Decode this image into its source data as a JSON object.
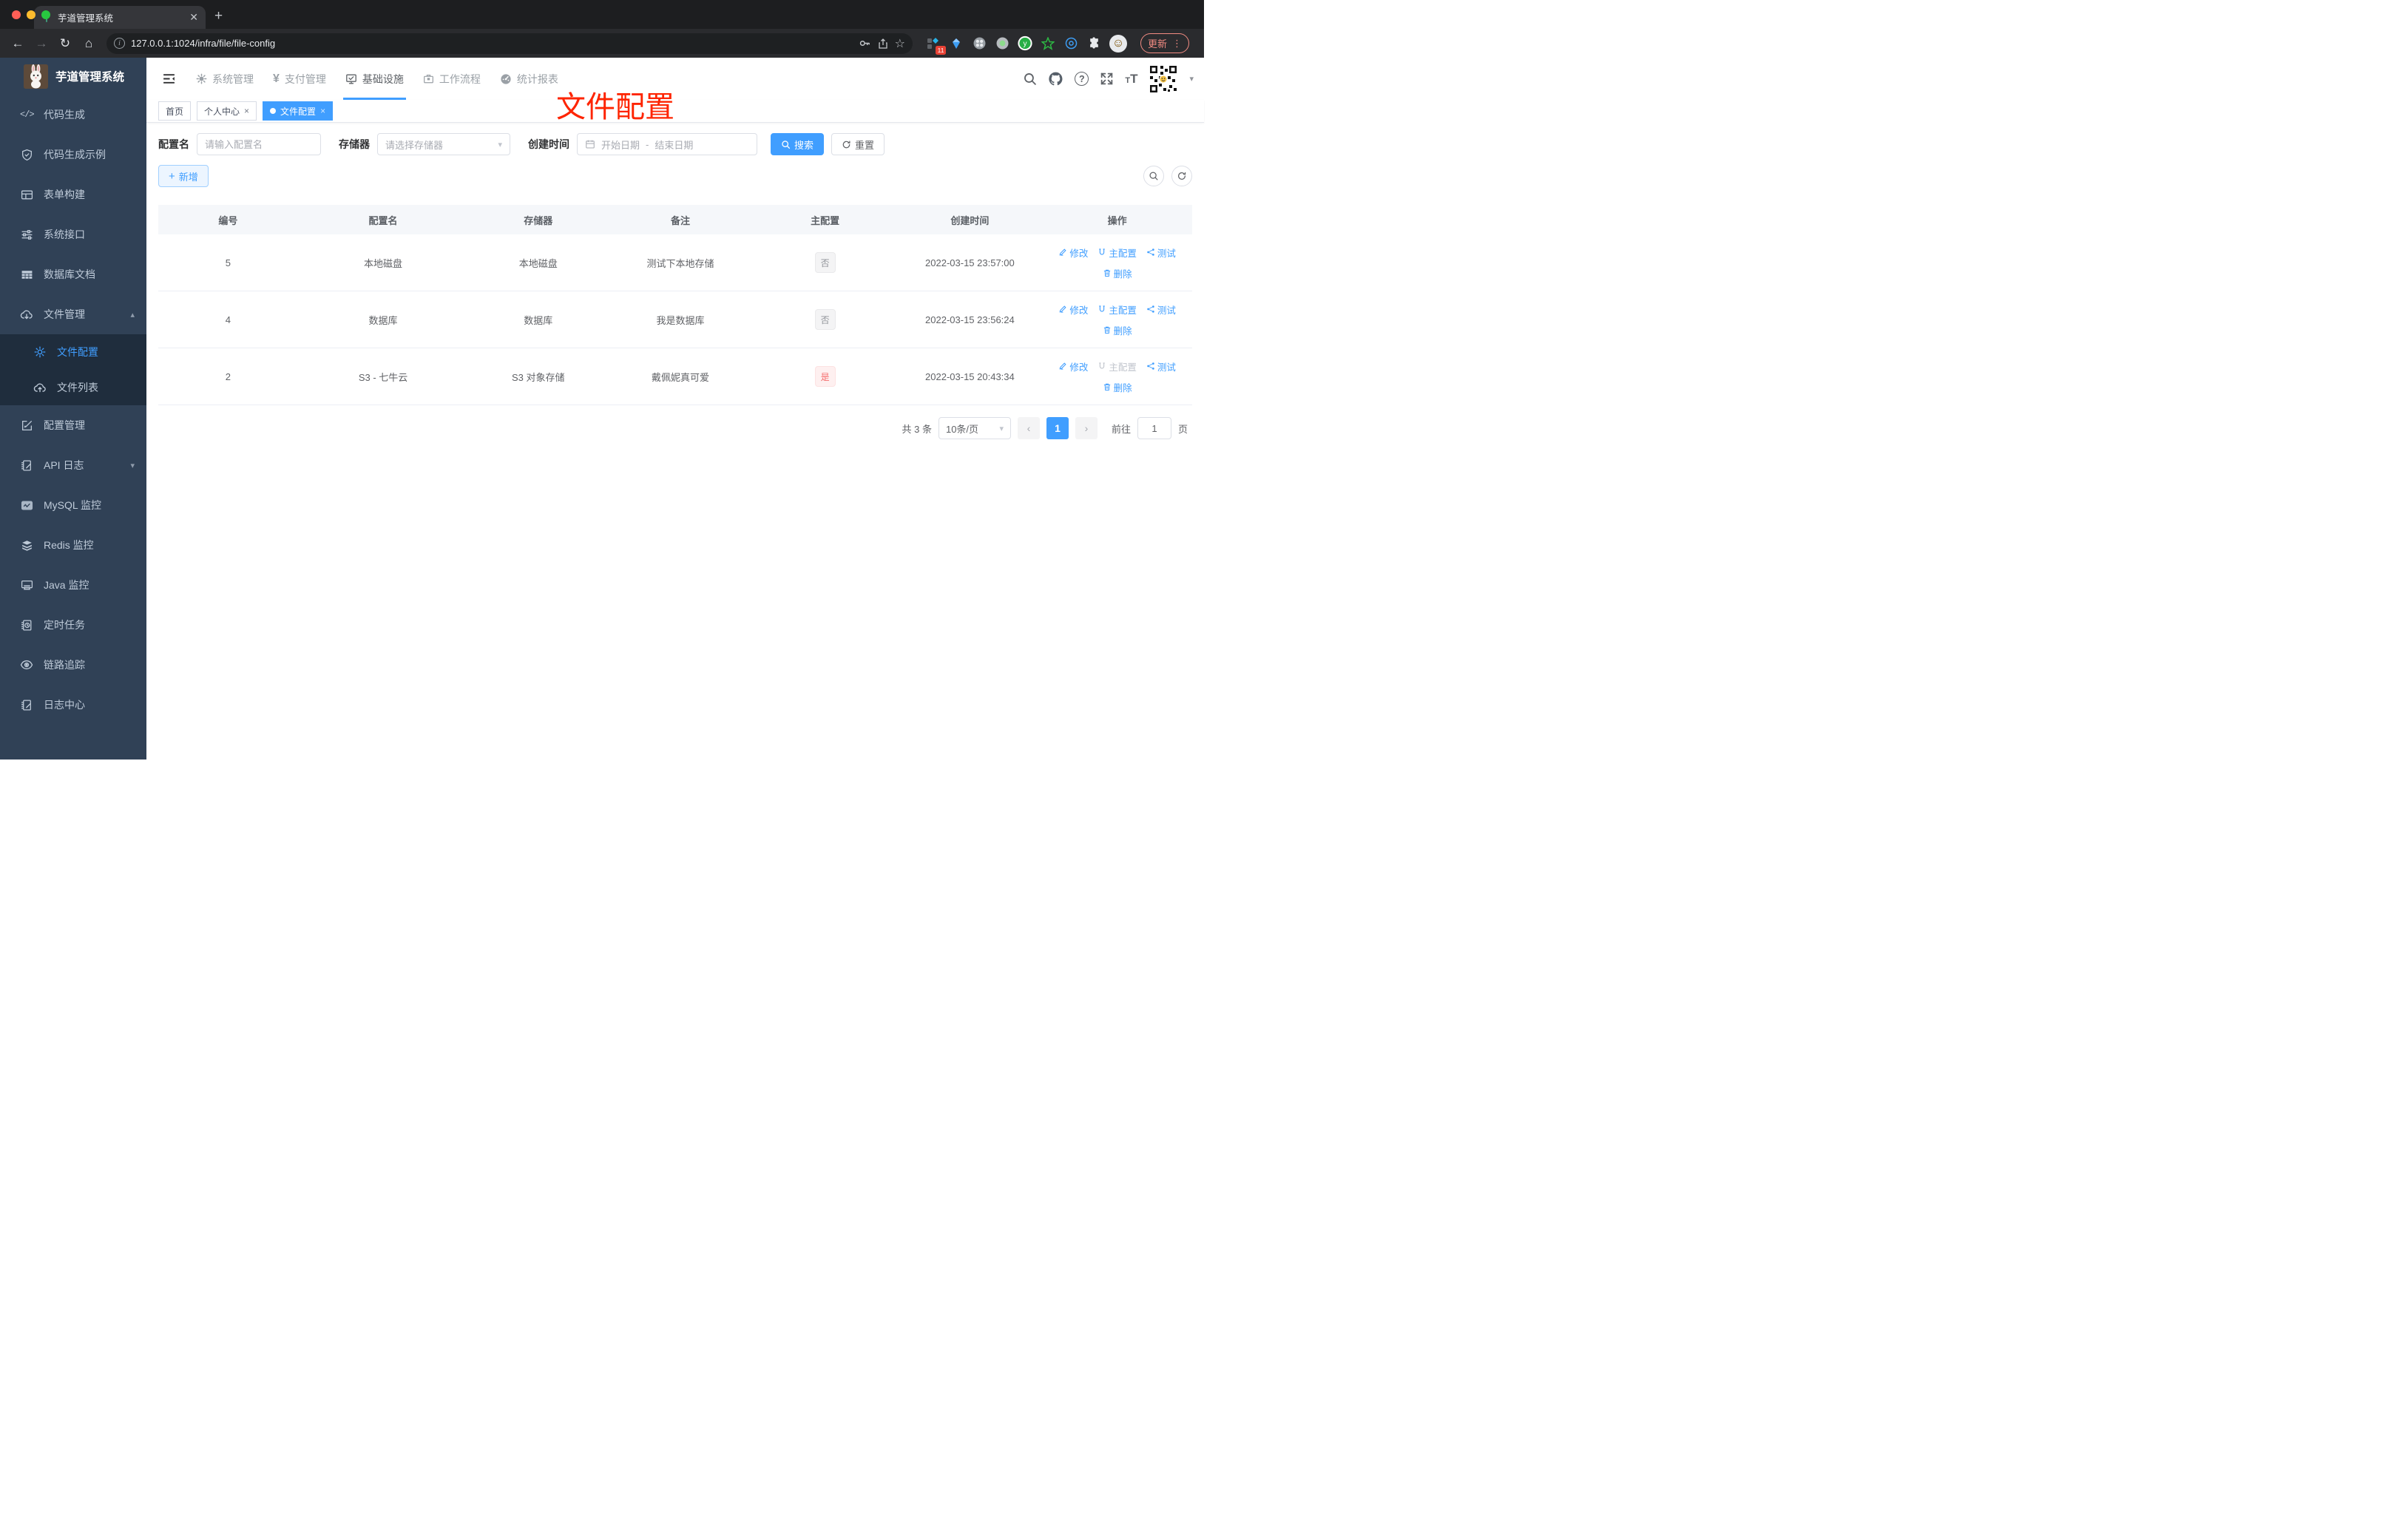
{
  "browser": {
    "tab_title": "芋道管理系统",
    "url": "127.0.0.1:1024/infra/file/file-config",
    "update_label": "更新",
    "extension_badge": "11"
  },
  "sidebar": {
    "logo_title": "芋道管理系统",
    "items": [
      {
        "icon": "code-icon",
        "label": "代码生成"
      },
      {
        "icon": "shield-check-icon",
        "label": "代码生成示例"
      },
      {
        "icon": "form-grid-icon",
        "label": "表单构建"
      },
      {
        "icon": "sliders-icon",
        "label": "系统接口"
      },
      {
        "icon": "table-icon",
        "label": "数据库文档"
      },
      {
        "icon": "cloud-download-icon",
        "label": "文件管理"
      },
      {
        "icon": "gear-icon",
        "label": "文件配置"
      },
      {
        "icon": "cloud-upload-icon",
        "label": "文件列表"
      },
      {
        "icon": "edit-square-icon",
        "label": "配置管理"
      },
      {
        "icon": "note-edit-icon",
        "label": "API 日志"
      },
      {
        "icon": "chart-monitor-icon",
        "label": "MySQL 监控"
      },
      {
        "icon": "layers-icon",
        "label": "Redis 监控"
      },
      {
        "icon": "monitor-icon",
        "label": "Java 监控"
      },
      {
        "icon": "schedule-icon",
        "label": "定时任务"
      },
      {
        "icon": "eye-icon",
        "label": "链路追踪"
      },
      {
        "icon": "log-edit-icon",
        "label": "日志中心"
      }
    ]
  },
  "header": {
    "nav": [
      {
        "icon": "gear-icon",
        "label": "系统管理"
      },
      {
        "icon": "yen-icon",
        "label": "支付管理"
      },
      {
        "icon": "monitor-check-icon",
        "label": "基础设施"
      },
      {
        "icon": "briefcase-icon",
        "label": "工作流程"
      },
      {
        "icon": "gauge-icon",
        "label": "统计报表"
      }
    ]
  },
  "tags": {
    "home": "首页",
    "profile": "个人中心",
    "current": "文件配置"
  },
  "annotation": {
    "text": "文件配置",
    "color": "#fe2400"
  },
  "filters": {
    "name_label": "配置名",
    "name_placeholder": "请输入配置名",
    "storage_label": "存储器",
    "storage_placeholder": "请选择存储器",
    "date_label": "创建时间",
    "date_start_placeholder": "开始日期",
    "date_separator": "-",
    "date_end_placeholder": "结束日期",
    "search_label": "搜索",
    "reset_label": "重置"
  },
  "toolbar": {
    "add_label": "新增"
  },
  "table": {
    "headers": [
      "编号",
      "配置名",
      "存储器",
      "备注",
      "主配置",
      "创建时间",
      "操作"
    ],
    "actions": {
      "edit": "修改",
      "master": "主配置",
      "test": "测试",
      "delete": "删除"
    },
    "rows": [
      {
        "id": "5",
        "name": "本地磁盘",
        "storage": "本地磁盘",
        "remark": "测试下本地存储",
        "master": "否",
        "created": "2022-03-15 23:57:00"
      },
      {
        "id": "4",
        "name": "数据库",
        "storage": "数据库",
        "remark": "我是数据库",
        "master": "否",
        "created": "2022-03-15 23:56:24"
      },
      {
        "id": "2",
        "name": "S3 - 七牛云",
        "storage": "S3 对象存储",
        "remark": "戴佩妮真可爱",
        "master": "是",
        "created": "2022-03-15 20:43:34"
      }
    ]
  },
  "pagination": {
    "total": "共 3 条",
    "page_size": "10条/页",
    "current": "1",
    "goto_label": "前往",
    "goto_value": "1",
    "page_unit": "页"
  },
  "colors": {
    "accent": "#409eff",
    "danger": "#f56c6c"
  }
}
